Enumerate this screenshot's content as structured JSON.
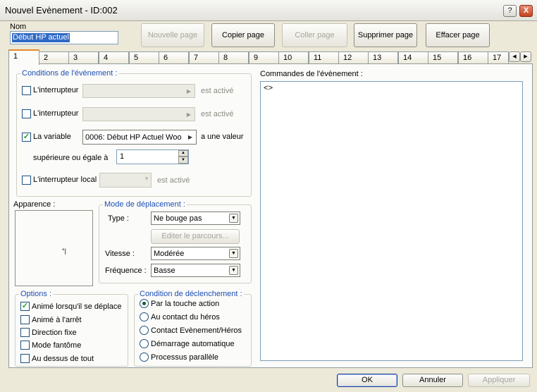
{
  "window": {
    "title": "Nouvel Evènement - ID:002",
    "help": "?",
    "close": "X"
  },
  "name": {
    "label": "Nom",
    "value": "Début HP actuel"
  },
  "page_buttons": {
    "new": "Nouvelle page",
    "copy": "Copier page",
    "paste": "Coller page",
    "delete": "Supprimer page",
    "clear": "Effacer page"
  },
  "tabs": [
    "1",
    "2",
    "3",
    "4",
    "5",
    "6",
    "7",
    "8",
    "9",
    "10",
    "11",
    "12",
    "13",
    "14",
    "15",
    "16",
    "17"
  ],
  "tab_scroll": {
    "left": "◀",
    "right": "▶"
  },
  "conditions": {
    "title": "Conditions de l'évènement :",
    "switch1": {
      "label": "L'interrupteur",
      "value": "",
      "suffix": "est activé",
      "checked": false
    },
    "switch2": {
      "label": "L'interrupteur",
      "value": "",
      "suffix": "est activé",
      "checked": false
    },
    "variable": {
      "label": "La variable",
      "value": "0006: Début HP Actuel Woo",
      "suffix": "a une valeur",
      "checked": true
    },
    "compare": {
      "label": "supérieure ou égale à",
      "value": "1"
    },
    "local": {
      "label": "L'interrupteur local",
      "value": "",
      "suffix": "est activé",
      "checked": false
    }
  },
  "appearance": {
    "label": "Apparence :",
    "glyph": "°|"
  },
  "movement": {
    "title": "Mode de déplacement :",
    "type_label": "Type :",
    "type_value": "Ne bouge pas",
    "edit_route": "Editer le parcours...",
    "speed_label": "Vitesse :",
    "speed_value": "Modérée",
    "freq_label": "Fréquence :",
    "freq_value": "Basse"
  },
  "options": {
    "title": "Options :",
    "items": [
      {
        "label": "Animé lorsqu'il se déplace",
        "checked": true
      },
      {
        "label": "Animé à l'arrêt",
        "checked": false
      },
      {
        "label": "Direction fixe",
        "checked": false
      },
      {
        "label": "Mode fantôme",
        "checked": false
      },
      {
        "label": "Au dessus de tout",
        "checked": false
      }
    ]
  },
  "trigger": {
    "title": "Condition de déclenchement :",
    "items": [
      {
        "label": "Par la touche action",
        "selected": true
      },
      {
        "label": "Au contact du héros",
        "selected": false
      },
      {
        "label": "Contact Evènement/Héros",
        "selected": false
      },
      {
        "label": "Démarrage automatique",
        "selected": false
      },
      {
        "label": "Processus parallèle",
        "selected": false
      }
    ]
  },
  "commands": {
    "label": "Commandes de l'évènement :",
    "lines": [
      "<>"
    ]
  },
  "footer": {
    "ok": "OK",
    "cancel": "Annuler",
    "apply": "Appliquer"
  },
  "colors": {
    "accent": "#1d4fb5",
    "selection": "#316ac5",
    "tab_highlight": "#e68b2c"
  }
}
